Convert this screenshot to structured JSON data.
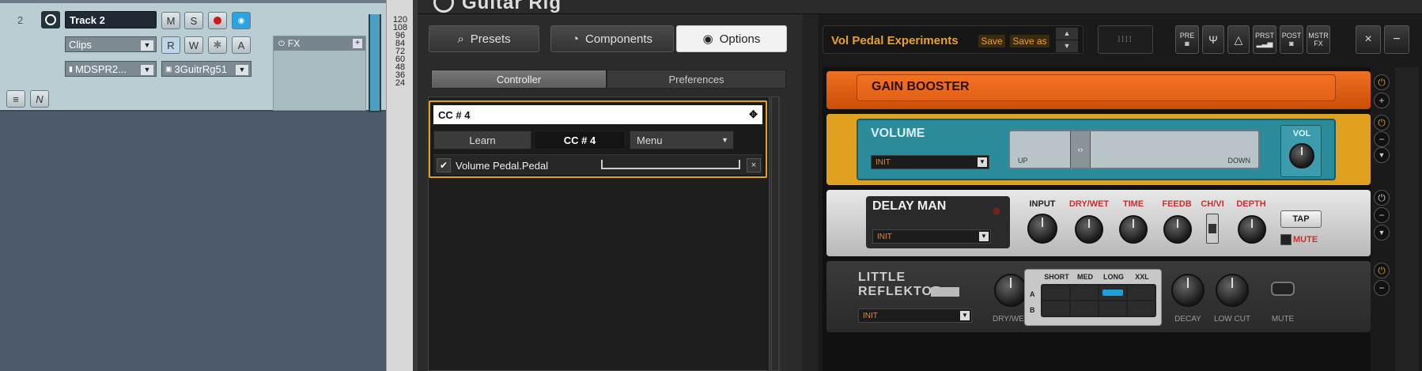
{
  "daw": {
    "track_number": "2",
    "track_name": "Track 2",
    "btn_m": "M",
    "btn_s": "S",
    "btn_r": "R",
    "btn_w": "W",
    "btn_a": "A",
    "clips_label": "Clips",
    "input_label": "MDSPR2...",
    "plugin_label": "3GuitrRg51",
    "fx_label": "FX",
    "scale_values": [
      "120",
      "108",
      "96",
      "84",
      "72",
      "60",
      "48",
      "36",
      "24"
    ],
    "meter_level": 0.98
  },
  "guitar_rig": {
    "title": "Guitar Rig",
    "tabs": [
      {
        "label": "Presets",
        "icon": "search-icon"
      },
      {
        "label": "Components",
        "icon": "gauge-icon"
      },
      {
        "label": "Options",
        "icon": "radio-icon"
      }
    ],
    "sub_tabs": [
      "Controller",
      "Preferences"
    ],
    "controller": {
      "cc_select": "CC # 4",
      "learn_label": "Learn",
      "cc_value": "CC # 4",
      "menu_label": "Menu",
      "assignment_name": "Volume Pedal.Pedal",
      "assignment_checked": true
    },
    "rack_header": {
      "preset_name": "Vol Pedal Experiments",
      "save_label": "Save",
      "save_as_label": "Save as",
      "tool_buttons": [
        "PRE",
        "",
        "",
        "PRST",
        "POST",
        "MSTR"
      ]
    },
    "modules": {
      "gain_booster": {
        "title": "GAIN BOOSTER"
      },
      "volume": {
        "title": "VOLUME",
        "preset": "INIT",
        "up_label": "UP",
        "down_label": "DOWN",
        "vol_label": "VOL"
      },
      "delay_man": {
        "title": "DELAY MAN",
        "preset": "INIT",
        "knobs": [
          "INPUT",
          "DRY/WET",
          "TIME",
          "FEEDB",
          "CH/VI",
          "DEPTH"
        ],
        "tap_label": "TAP",
        "mute_label": "MUTE"
      },
      "little_reflektor": {
        "title_line1": "LITTLE",
        "title_line2": "REFLEKTOR",
        "preset": "INIT",
        "drywet_label": "DRY/WET",
        "sizes": [
          "SHORT",
          "MED",
          "LONG",
          "XXL"
        ],
        "rows": [
          "A",
          "B"
        ],
        "decay_label": "DECAY",
        "lowcut_label": "LOW CUT",
        "mute_label": "MUTE"
      }
    }
  },
  "colors": {
    "accent_orange": "#e0a020",
    "gain_orange": "#e06010",
    "volume_teal": "#2a8c9a",
    "selected_blue": "#1f9fd8"
  }
}
